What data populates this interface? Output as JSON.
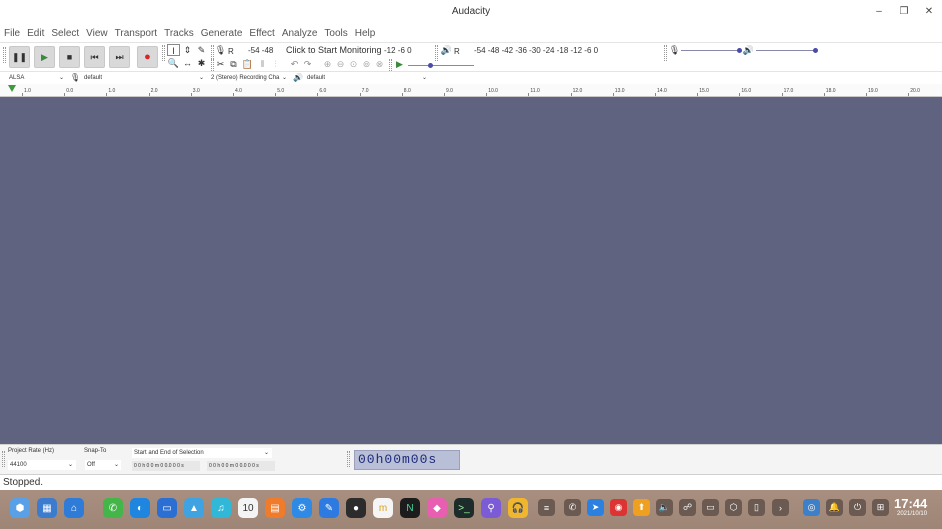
{
  "window": {
    "title": "Audacity"
  },
  "menu": [
    "File",
    "Edit",
    "Select",
    "View",
    "Transport",
    "Tracks",
    "Generate",
    "Effect",
    "Analyze",
    "Tools",
    "Help"
  ],
  "meters": {
    "record_scale_left": "-54  -48",
    "monitor_label": "Click to Start Monitoring",
    "record_scale_right": "-12   -6   0",
    "play_scale": "-54   -48   -42   -36   -30   -24   -18   -12    -6    0",
    "record_channel": "R",
    "play_channel": "R"
  },
  "devices": {
    "host": "ALSA",
    "recording_device": "default",
    "channels": "2 (Stereo) Recording Cha",
    "playback_device": "default"
  },
  "ruler": {
    "ticks": [
      "1.0",
      "0.0",
      "1.0",
      "2.0",
      "3.0",
      "4.0",
      "5.0",
      "6.0",
      "7.0",
      "8.0",
      "9.0",
      "10.0",
      "11.0",
      "12.0",
      "13.0",
      "14.0",
      "15.0",
      "16.0",
      "17.0",
      "18.0",
      "19.0",
      "20.0"
    ]
  },
  "selection": {
    "project_rate_label": "Project Rate (Hz)",
    "project_rate_value": "44100",
    "snap_label": "Snap-To",
    "snap_value": "Off",
    "mode_label": "Start and End of Selection",
    "start_time": "0 0 h 0 0 m 0 0.0 0 0 s",
    "end_time": "0 0 h 0 0 m 0 0.0 0 0 s",
    "audio_position": "00h00m00s"
  },
  "status": {
    "text": "Stopped."
  },
  "clock": {
    "time": "17:44",
    "date": "2021/10/10"
  },
  "colors": {
    "track_background": "#5f6380",
    "record": "#d9262b"
  }
}
